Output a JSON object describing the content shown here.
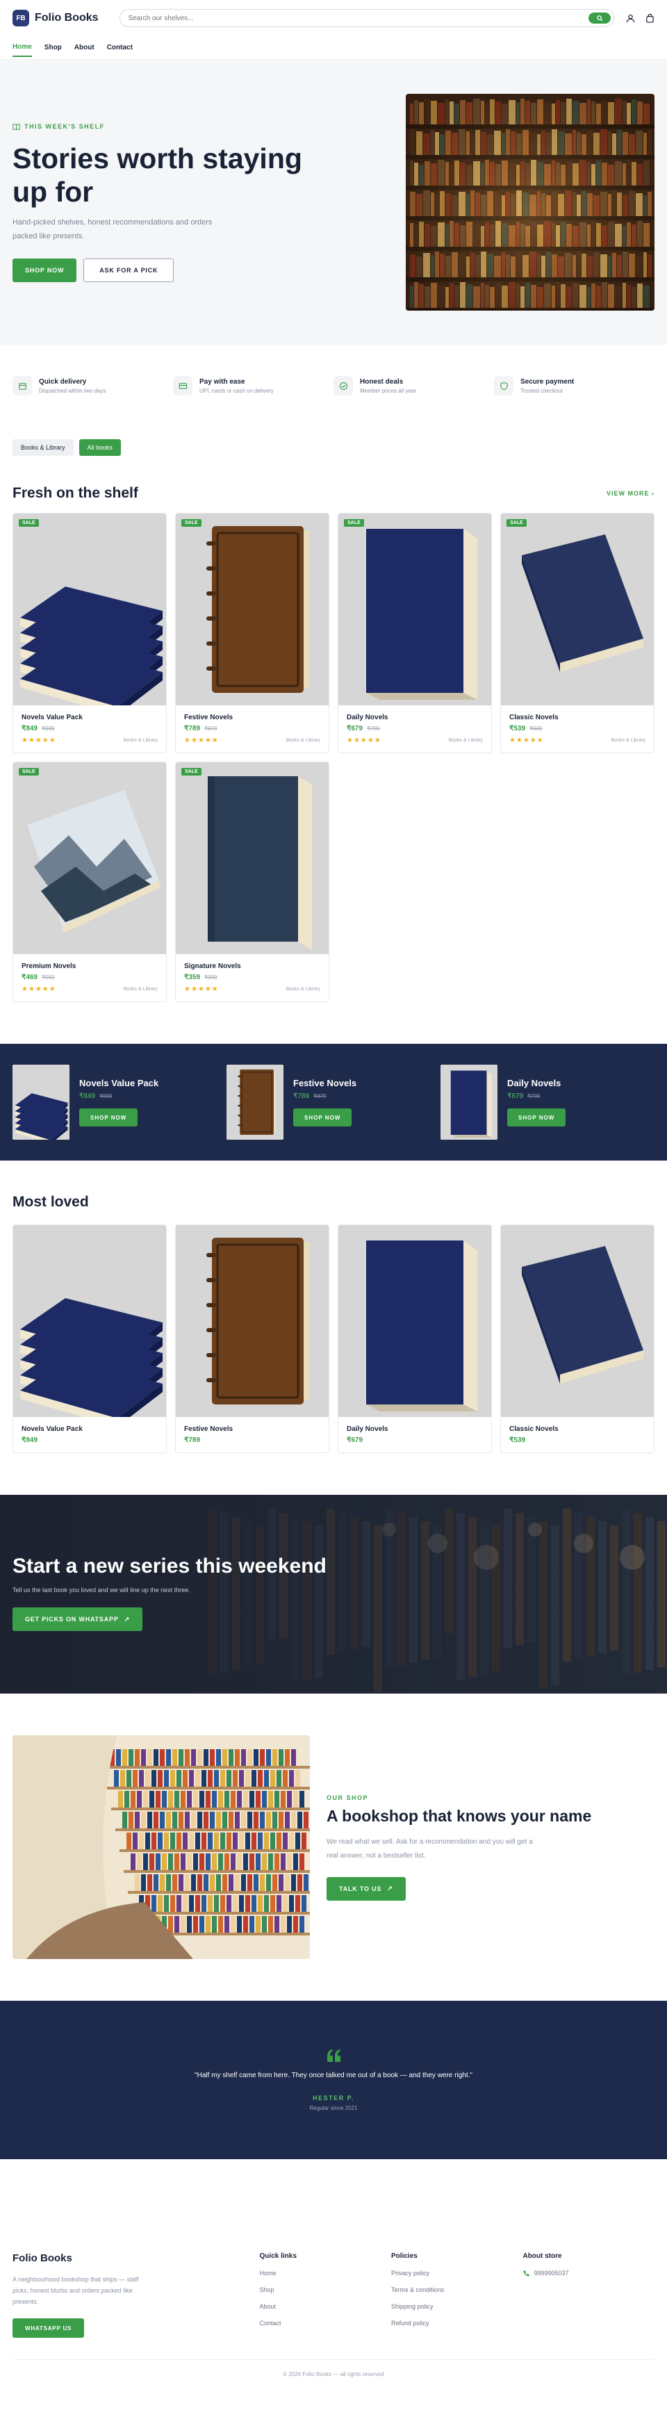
{
  "brand": {
    "logo_mark": "FB",
    "name": "Folio Books"
  },
  "search": {
    "placeholder": "Search our shelves..."
  },
  "nav": [
    {
      "label": "Home"
    },
    {
      "label": "Shop"
    },
    {
      "label": "About"
    },
    {
      "label": "Contact"
    }
  ],
  "hero": {
    "eyebrow": "THIS WEEK'S SHELF",
    "title": "Stories worth staying up for",
    "subtitle": "Hand-picked shelves, honest recommendations and orders packed like presents.",
    "primary_cta": "SHOP NOW",
    "secondary_cta": "ASK FOR A PICK"
  },
  "features": [
    {
      "title": "Quick delivery",
      "subtitle": "Dispatched within two days",
      "icon": "box-icon"
    },
    {
      "title": "Pay with ease",
      "subtitle": "UPI, cards or cash on delivery",
      "icon": "card-icon"
    },
    {
      "title": "Honest deals",
      "subtitle": "Member prices all year",
      "icon": "check-icon"
    },
    {
      "title": "Secure payment",
      "subtitle": "Trusted checkout",
      "icon": "shield-icon"
    }
  ],
  "chips": [
    "Books & Library",
    "All books"
  ],
  "fresh": {
    "title": "Fresh on the shelf",
    "view_more": "VIEW MORE",
    "products": [
      {
        "badge": "SALE",
        "name": "Novels Value Pack",
        "price": "₹849",
        "old": "₹999",
        "stars": "★★★★★",
        "category": "Books & Library",
        "cover": "stack"
      },
      {
        "badge": "SALE",
        "name": "Festive Novels",
        "price": "₹789",
        "old": "₹879",
        "stars": "★★★★★",
        "category": "Books & Library",
        "cover": "leather"
      },
      {
        "badge": "SALE",
        "name": "Daily Novels",
        "price": "₹679",
        "old": "₹799",
        "stars": "★★★★★",
        "category": "Books & Library",
        "cover": "navy-standing"
      },
      {
        "badge": "SALE",
        "name": "Classic Novels",
        "price": "₹539",
        "old": "₹639",
        "stars": "★★★★★",
        "category": "Books & Library",
        "cover": "navy-flat"
      },
      {
        "badge": "SALE",
        "name": "Premium Novels",
        "price": "₹469",
        "old": "₹559",
        "stars": "★★★★★",
        "category": "Books & Library",
        "cover": "mountain"
      },
      {
        "badge": "SALE",
        "name": "Signature Novels",
        "price": "₹359",
        "old": "₹399",
        "stars": "★★★★★",
        "category": "Books & Library",
        "cover": "slate"
      }
    ]
  },
  "promos": [
    {
      "name": "Novels Value Pack",
      "price": "₹849",
      "old": "₹999",
      "cta": "SHOP NOW"
    },
    {
      "name": "Festive Novels",
      "price": "₹789",
      "old": "₹879",
      "cta": "SHOP NOW"
    },
    {
      "name": "Daily Novels",
      "price": "₹679",
      "old": "₹799",
      "cta": "SHOP NOW"
    }
  ],
  "loved": {
    "title": "Most loved",
    "products": [
      {
        "name": "Novels Value Pack",
        "price": "₹849"
      },
      {
        "name": "Festive Novels",
        "price": "₹789"
      },
      {
        "name": "Daily Novels",
        "price": "₹679"
      },
      {
        "name": "Classic Novels",
        "price": "₹539"
      }
    ]
  },
  "cta": {
    "title": "Start a new series this weekend",
    "subtitle": "Tell us the last book you loved and we will line up the next three.",
    "button": "GET PICKS ON WHATSAPP"
  },
  "about": {
    "eyebrow": "OUR SHOP",
    "title": "A bookshop that knows your name",
    "text": "We read what we sell. Ask for a recommendation and you will get a real answer, not a bestseller list.",
    "button": "TALK TO US"
  },
  "testimonial": {
    "quote": "\"Half my shelf came from here. They once talked me out of a book — and they were right.\"",
    "name": "HESTER P.",
    "since": "Regular since 2021"
  },
  "footer": {
    "brand": "Folio Books",
    "about": "A neighbourhood bookshop that ships — staff picks, honest blurbs and orders packed like presents.",
    "whatsapp": "WHATSAPP US",
    "quick_links_title": "Quick links",
    "quick_links": [
      "Home",
      "Shop",
      "About",
      "Contact"
    ],
    "policies_title": "Policies",
    "policies": [
      "Privacy policy",
      "Terms & conditions",
      "Shipping policy",
      "Refund policy"
    ],
    "store_title": "About store",
    "phone": "9999905037",
    "copyright": "© 2026 Folio Books — all rights reserved"
  },
  "colors": {
    "accent": "#3a9e48",
    "navy": "#1e2a4c",
    "ink": "#1a2236"
  }
}
